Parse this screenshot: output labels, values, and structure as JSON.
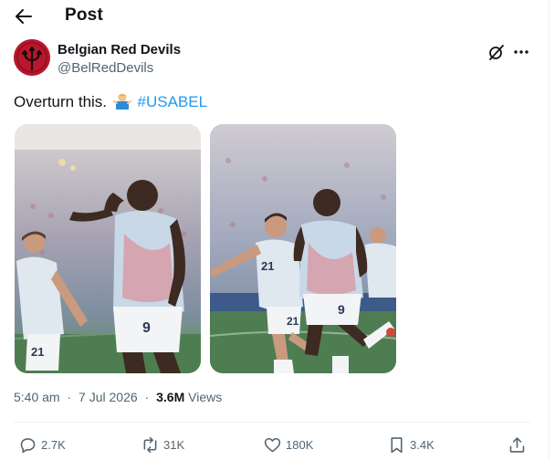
{
  "header": {
    "title": "Post"
  },
  "author": {
    "display_name": "Belgian Red Devils",
    "handle": "@BelRedDevils"
  },
  "tweet": {
    "text": "Overturn this.",
    "emoji": "man-shrugging",
    "hashtag": "#USABEL"
  },
  "media": [
    {
      "icon": "photo-player-celebrating-shush"
    },
    {
      "icon": "photo-players-running-celebration"
    }
  ],
  "meta": {
    "time": "5:40 am",
    "separator": "·",
    "date": "7 Jul 2026",
    "views_count": "3.6M",
    "views_label": "Views"
  },
  "actions": {
    "replies": "2.7K",
    "reposts": "31K",
    "likes": "180K",
    "bookmarks": "3.4K"
  },
  "colors": {
    "accent": "#1d9bf0",
    "muted": "#536471",
    "avatar_red": "#b8172c"
  }
}
